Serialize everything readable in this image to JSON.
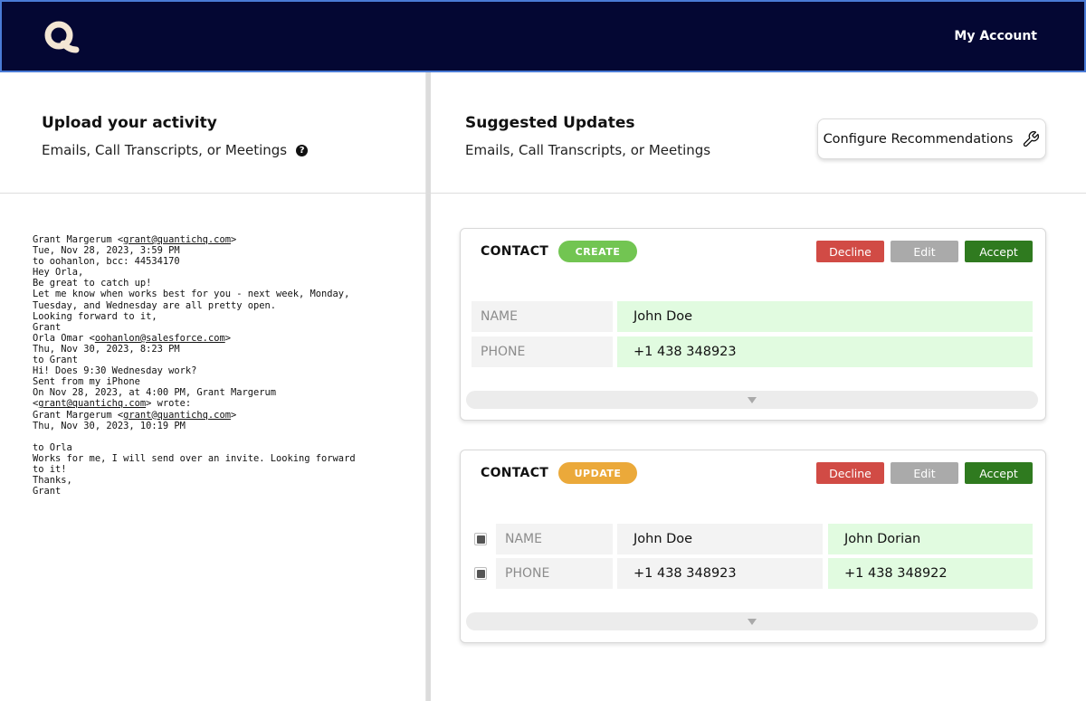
{
  "header": {
    "account_label": "My Account"
  },
  "left_panel": {
    "title": "Upload your activity",
    "subtitle": "Emails, Call Transcripts, or Meetings",
    "transcript_lines": [
      "Grant Margerum <grant@quantichq.com>",
      "Tue, Nov 28, 2023, 3:59 PM",
      "to oohanlon, bcc: 44534170",
      "Hey Orla,",
      "Be great to catch up!",
      "Let me know when works best for you - next week, Monday,",
      "Tuesday, and Wednesday are all pretty open.",
      "Looking forward to it,",
      "Grant",
      "Orla Omar <oohanlon@salesforce.com>",
      "Thu, Nov 30, 2023, 8:23 PM",
      "to Grant",
      "Hi! Does 9:30 Wednesday work?",
      "Sent from my iPhone",
      "On Nov 28, 2023, at 4:00 PM, Grant Margerum",
      "<grant@quantichq.com> wrote:",
      "Grant Margerum <grant@quantichq.com>",
      "Thu, Nov 30, 2023, 10:19 PM",
      "",
      "to Orla",
      "Works for me, I will send over an invite. Looking forward",
      "to it!",
      "Thanks,",
      "Grant"
    ]
  },
  "right_panel": {
    "title": "Suggested Updates",
    "subtitle": "Emails, Call Transcripts, or Meetings",
    "configure_label": "Configure Recommendations"
  },
  "colors": {
    "create": "#72c552",
    "update": "#eba93a",
    "decline": "#d14b45",
    "edit": "#aaaaaa",
    "accept": "#2f7a1f",
    "highlight": "#e1fbe0"
  },
  "cards": [
    {
      "type": "CONTACT",
      "badge": "CREATE",
      "actions": {
        "decline": "Decline",
        "edit": "Edit",
        "accept": "Accept"
      },
      "fields": [
        {
          "label": "NAME",
          "value": "John Doe"
        },
        {
          "label": "PHONE",
          "value": "+1 438 348923"
        }
      ]
    },
    {
      "type": "CONTACT",
      "badge": "UPDATE",
      "actions": {
        "decline": "Decline",
        "edit": "Edit",
        "accept": "Accept"
      },
      "fields": [
        {
          "label": "NAME",
          "old_value": "John Doe",
          "new_value": "John Dorian",
          "selected": true
        },
        {
          "label": "PHONE",
          "old_value": "+1 438 348923",
          "new_value": "+1 438 348922",
          "selected": true
        }
      ]
    }
  ]
}
